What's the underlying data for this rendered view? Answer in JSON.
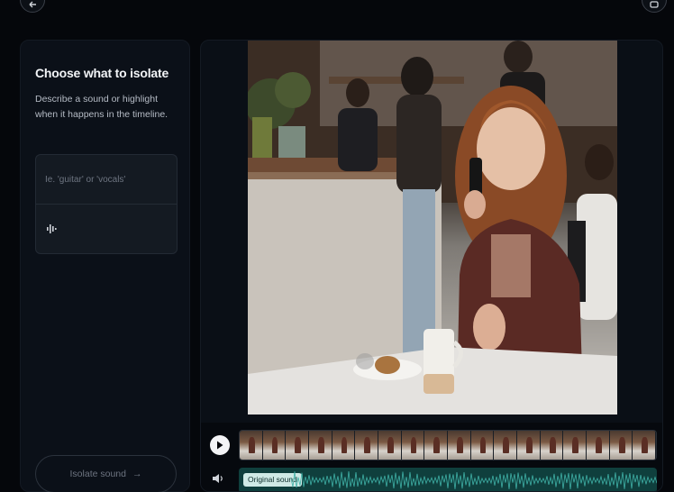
{
  "left_panel": {
    "title": "Choose what to isolate",
    "description": "Describe a sound or highlight when it happens in the timeline.",
    "prompt_placeholder": "Ie. 'guitar' or 'vocals'",
    "isolate_button_label": "Isolate sound",
    "isolate_button_arrow": "→"
  },
  "timeline": {
    "audio_track_label": "Original sound",
    "thumbnail_count": 18
  },
  "colors": {
    "background": "#05070b",
    "panel": "#0b1018",
    "audio_track": "#0f3f3d",
    "audio_label": "#cfeae6"
  },
  "icons": {
    "top_left": "undo-icon",
    "top_right": "more-icon",
    "prompt": "sound-wave-icon",
    "play": "play-icon",
    "volume": "volume-icon"
  }
}
